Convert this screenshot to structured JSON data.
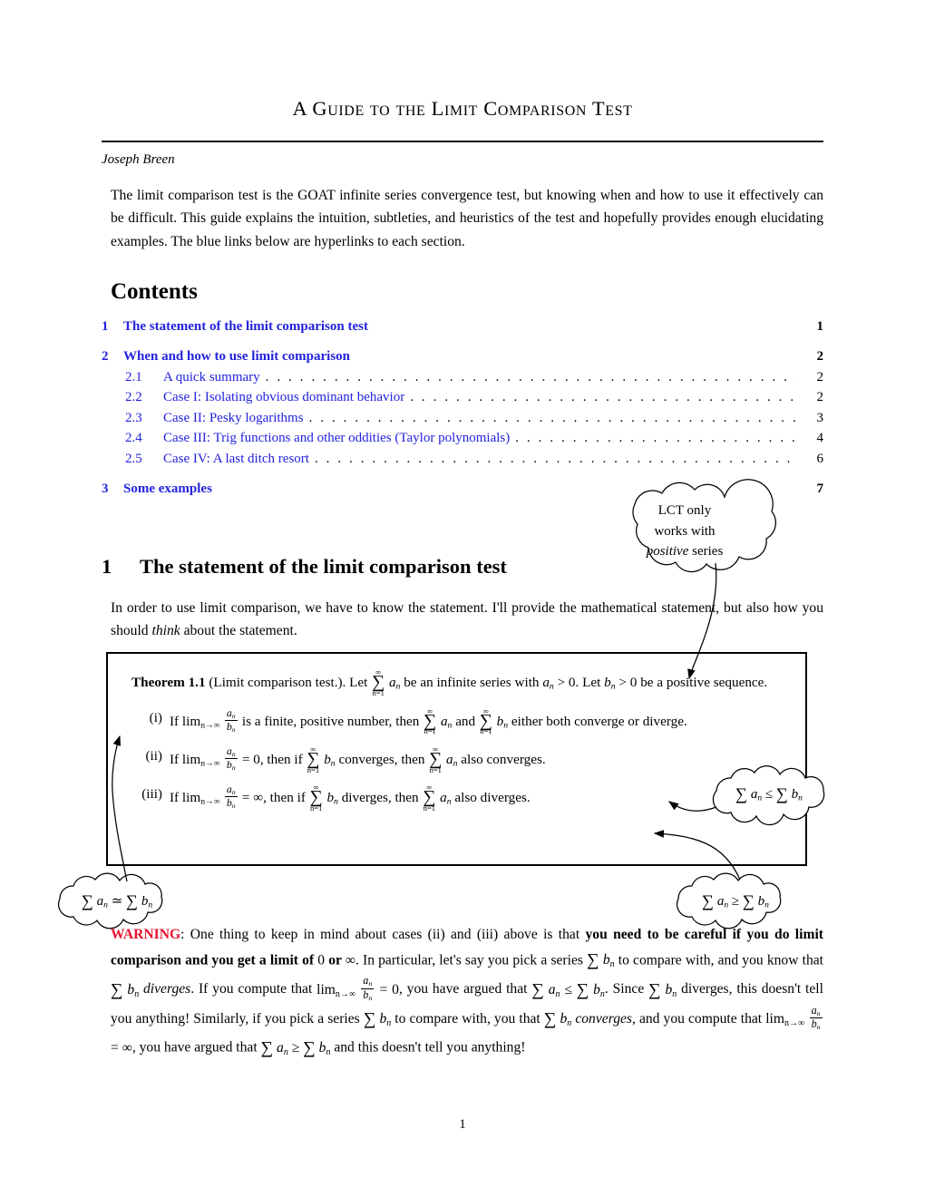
{
  "document": {
    "title": "A Guide to the Limit Comparison Test",
    "author": "Joseph Breen",
    "abstract": "The limit comparison test is the GOAT infinite series convergence test, but knowing when and how to use it effectively can be difficult. This guide explains the intuition, subtleties, and heuristics of the test and hopefully provides enough elucidating examples. The blue links below are hyperlinks to each section.",
    "page_number": "1",
    "link_color": "#2222dd",
    "warning_color": "#e8112d"
  },
  "contents": {
    "heading": "Contents",
    "entries": [
      {
        "number": "1",
        "label": "The statement of the limit comparison test",
        "page": "1",
        "level": "top",
        "dots": false
      },
      {
        "number": "2",
        "label": "When and how to use limit comparison",
        "page": "2",
        "level": "top",
        "dots": false
      },
      {
        "number": "2.1",
        "label": "A quick summary",
        "page": "2",
        "level": "sub",
        "dots": true
      },
      {
        "number": "2.2",
        "label": "Case I: Isolating obvious dominant behavior",
        "page": "2",
        "level": "sub",
        "dots": true
      },
      {
        "number": "2.3",
        "label": "Case II: Pesky logarithms",
        "page": "3",
        "level": "sub",
        "dots": true
      },
      {
        "number": "2.4",
        "label": "Case III: Trig functions and other oddities (Taylor polynomials)",
        "page": "4",
        "level": "sub",
        "dots": true
      },
      {
        "number": "2.5",
        "label": "Case IV: A last ditch resort",
        "page": "6",
        "level": "sub",
        "dots": true
      },
      {
        "number": "3",
        "label": "Some examples",
        "page": "7",
        "level": "top",
        "dots": false
      }
    ]
  },
  "section1": {
    "number": "1",
    "title": "The statement of the limit comparison test",
    "intro_part1": "In order to use limit comparison, we have to know the statement. I'll provide the mathematical statement, but also how you should ",
    "intro_italic": "think",
    "intro_part2": " about the statement."
  },
  "theorem": {
    "label": "Theorem 1.1",
    "name": "(Limit comparison test.).",
    "statement_a": "Let",
    "statement_b": "be an infinite series with",
    "statement_c": ". Let",
    "statement_d": "be a positive sequence.",
    "items": [
      {
        "marker": "(i)",
        "text_a": "If",
        "text_b": "is a finite, positive number, then",
        "text_c": "and",
        "text_d": "either both converge or diverge."
      },
      {
        "marker": "(ii)",
        "text_a": "If",
        "text_b": ", then if",
        "text_c": "converges, then",
        "text_d": "also converges."
      },
      {
        "marker": "(iii)",
        "text_a": "If",
        "text_b": ", then if",
        "text_c": "diverges, then",
        "text_d": "also diverges."
      }
    ]
  },
  "callouts": [
    {
      "id": "positive-series",
      "line1": "LCT only",
      "line2": "works with",
      "line3_italic": "positive",
      "line3_rest": " series"
    },
    {
      "id": "leq",
      "math": "∑ a_n ≤ ∑ b_n"
    },
    {
      "id": "simeq",
      "math": "∑ a_n ≃ ∑ b_n"
    },
    {
      "id": "geq",
      "math": "∑ a_n ≥ ∑ b_n"
    }
  ],
  "warning": {
    "label": "WARNING",
    "t1": ": One thing to keep in mind about cases (ii) and (iii) above is that ",
    "bold1": "you need to be careful if you do limit comparison and you get a limit of ",
    "bold_zero": "0",
    "bold_or": " or ",
    "bold_inf": "∞",
    "t2": ". In particular, let's say you pick a series ",
    "t3": " to compare with, and you know that ",
    "div_italic": "diverges",
    "t4": ". If you compute that ",
    "t5": ", you have argued that ",
    "t6": ". Since ",
    "t7": " diverges, this doesn't tell you anything! Similarly, if you pick a series ",
    "t8": " to compare with, you that ",
    "conv_italic": "converges",
    "t9": ", and you compute that ",
    "t10": ", you have argued that ",
    "t11": " and this doesn't tell you anything!"
  }
}
